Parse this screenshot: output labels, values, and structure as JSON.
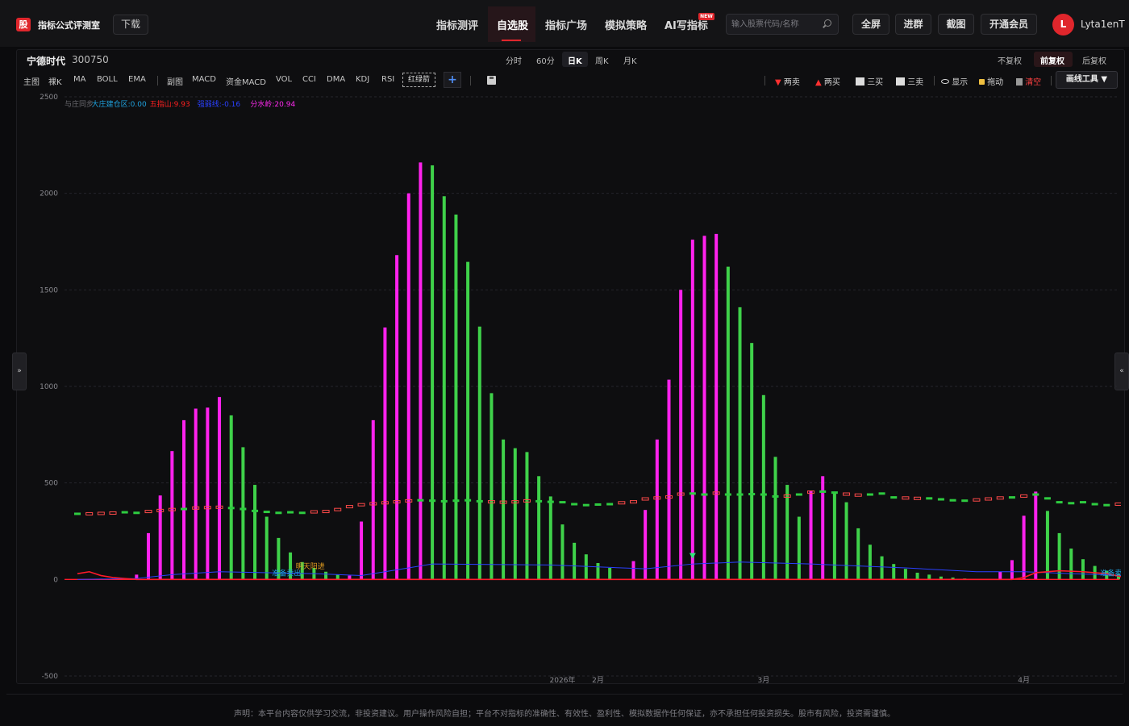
{
  "header": {
    "logo_char": "股",
    "site_title": "指标公式评测室",
    "download_label": "下载",
    "nav": [
      "指标测评",
      "自选股",
      "指标广场",
      "模拟策略",
      "AI写指标"
    ],
    "nav_active": "自选股",
    "new_badge": "NEW",
    "search_placeholder": "输入股票代码/名称",
    "buttons": [
      "全屏",
      "进群",
      "截图",
      "开通会员"
    ],
    "avatar_letter": "L",
    "username": "Lyta1enT"
  },
  "stock": {
    "name": "宁德时代",
    "code": "300750"
  },
  "periods": [
    "分时",
    "60分",
    "日K",
    "周K",
    "月K"
  ],
  "period_active": "日K",
  "adjust": [
    "不复权",
    "前复权",
    "后复权"
  ],
  "adjust_active": "前复权",
  "indicators_main": [
    "主图",
    "裸K",
    "MA",
    "BOLL",
    "EMA"
  ],
  "indicators_sub": [
    "副图",
    "MACD",
    "资金MACD",
    "VOL",
    "CCI",
    "DMA",
    "KDJ",
    "RSI"
  ],
  "highlight_indicator": "红绿箭",
  "add_label": "+",
  "tools": {
    "two_sell": "两卖",
    "two_buy": "两买",
    "three_buy": "三买",
    "three_sell": "三卖",
    "show": "显示",
    "drag": "拖动",
    "clear": "清空",
    "draw_tools": "画线工具 ▼"
  },
  "side": {
    "left": "»",
    "right": "«"
  },
  "chart_data": {
    "type": "bar",
    "legend": [
      {
        "label": "与庄同步",
        "color": "#6a6a70"
      },
      {
        "label": "大庄建仓区:0.00",
        "color": "#1fa3e0"
      },
      {
        "label": "五指山:9.93",
        "color": "#ff2020"
      },
      {
        "label": "强弱线:-0.16",
        "color": "#2a40ff"
      },
      {
        "label": "分水岭:20.94",
        "color": "#ff2af0"
      }
    ],
    "yticks": [
      2500,
      2000,
      1500,
      1000,
      500,
      0,
      -500
    ],
    "ylim": [
      -500,
      2500
    ],
    "xlabels": [
      {
        "i": 41,
        "label": "2026年"
      },
      {
        "i": 44,
        "label": "2月"
      },
      {
        "i": 58,
        "label": "3月"
      },
      {
        "i": 80,
        "label": "4月"
      }
    ],
    "annotations": [
      {
        "i": 19,
        "text": "明天阳进",
        "color": "#e8a020",
        "y": 55
      },
      {
        "i": 17,
        "text": "准备卖出",
        "color": "#1fa3e0",
        "y": 20
      },
      {
        "i": 87,
        "text": "准备卖出",
        "color": "#1fa3e0",
        "y": 20
      }
    ],
    "bars": [
      [
        0,
        "m"
      ],
      [
        0,
        "m"
      ],
      [
        0,
        "m"
      ],
      [
        0,
        "m"
      ],
      [
        0,
        "m"
      ],
      [
        25,
        "m"
      ],
      [
        240,
        "m"
      ],
      [
        435,
        "m"
      ],
      [
        665,
        "m"
      ],
      [
        825,
        "m"
      ],
      [
        885,
        "m"
      ],
      [
        890,
        "m"
      ],
      [
        945,
        "m"
      ],
      [
        850,
        "g"
      ],
      [
        685,
        "g"
      ],
      [
        490,
        "g"
      ],
      [
        325,
        "g"
      ],
      [
        215,
        "g"
      ],
      [
        140,
        "g"
      ],
      [
        90,
        "g"
      ],
      [
        60,
        "g"
      ],
      [
        40,
        "g"
      ],
      [
        25,
        "g"
      ],
      [
        20,
        "m"
      ],
      [
        300,
        "m"
      ],
      [
        825,
        "m"
      ],
      [
        1305,
        "m"
      ],
      [
        1680,
        "m"
      ],
      [
        2000,
        "m"
      ],
      [
        2160,
        "m"
      ],
      [
        2145,
        "g"
      ],
      [
        1985,
        "g"
      ],
      [
        1890,
        "g"
      ],
      [
        1645,
        "g"
      ],
      [
        1310,
        "g"
      ],
      [
        965,
        "g"
      ],
      [
        725,
        "g"
      ],
      [
        680,
        "g"
      ],
      [
        660,
        "g"
      ],
      [
        535,
        "g"
      ],
      [
        430,
        "g"
      ],
      [
        285,
        "g"
      ],
      [
        190,
        "g"
      ],
      [
        130,
        "g"
      ],
      [
        85,
        "g"
      ],
      [
        60,
        "g"
      ],
      [
        0,
        "m"
      ],
      [
        95,
        "m"
      ],
      [
        360,
        "m"
      ],
      [
        725,
        "m"
      ],
      [
        1035,
        "m"
      ],
      [
        1500,
        "m"
      ],
      [
        1760,
        "m"
      ],
      [
        1780,
        "m"
      ],
      [
        1790,
        "m"
      ],
      [
        1620,
        "g"
      ],
      [
        1410,
        "g"
      ],
      [
        1225,
        "g"
      ],
      [
        955,
        "g"
      ],
      [
        635,
        "g"
      ],
      [
        490,
        "g"
      ],
      [
        325,
        "g"
      ],
      [
        460,
        "m"
      ],
      [
        535,
        "m"
      ],
      [
        450,
        "g"
      ],
      [
        400,
        "g"
      ],
      [
        265,
        "g"
      ],
      [
        180,
        "g"
      ],
      [
        120,
        "g"
      ],
      [
        80,
        "g"
      ],
      [
        55,
        "g"
      ],
      [
        35,
        "g"
      ],
      [
        25,
        "g"
      ],
      [
        15,
        "g"
      ],
      [
        10,
        "g"
      ],
      [
        5,
        "g"
      ],
      [
        0,
        "m"
      ],
      [
        0,
        "m"
      ],
      [
        40,
        "m"
      ],
      [
        100,
        "m"
      ],
      [
        330,
        "m"
      ],
      [
        455,
        "m"
      ],
      [
        355,
        "g"
      ],
      [
        240,
        "g"
      ],
      [
        160,
        "g"
      ],
      [
        105,
        "g"
      ],
      [
        70,
        "g"
      ],
      [
        45,
        "g"
      ],
      [
        30,
        "g"
      ],
      [
        20,
        "g"
      ]
    ],
    "kline": [
      [
        340,
        "g"
      ],
      [
        338,
        "m"
      ],
      [
        340,
        "m"
      ],
      [
        342,
        "m"
      ],
      [
        348,
        "g"
      ],
      [
        345,
        "g"
      ],
      [
        350,
        "m"
      ],
      [
        355,
        "m"
      ],
      [
        360,
        "m"
      ],
      [
        365,
        "g"
      ],
      [
        368,
        "m"
      ],
      [
        370,
        "m"
      ],
      [
        372,
        "m"
      ],
      [
        370,
        "g"
      ],
      [
        365,
        "g"
      ],
      [
        355,
        "g"
      ],
      [
        350,
        "g"
      ],
      [
        345,
        "g"
      ],
      [
        348,
        "g"
      ],
      [
        345,
        "g"
      ],
      [
        348,
        "m"
      ],
      [
        350,
        "m"
      ],
      [
        360,
        "m"
      ],
      [
        375,
        "m"
      ],
      [
        385,
        "m"
      ],
      [
        390,
        "m"
      ],
      [
        395,
        "m"
      ],
      [
        400,
        "m"
      ],
      [
        405,
        "m"
      ],
      [
        410,
        "g"
      ],
      [
        408,
        "g"
      ],
      [
        405,
        "g"
      ],
      [
        408,
        "g"
      ],
      [
        410,
        "g"
      ],
      [
        405,
        "g"
      ],
      [
        400,
        "m"
      ],
      [
        398,
        "m"
      ],
      [
        400,
        "m"
      ],
      [
        405,
        "m"
      ],
      [
        405,
        "g"
      ],
      [
        402,
        "g"
      ],
      [
        400,
        "g"
      ],
      [
        390,
        "g"
      ],
      [
        385,
        "g"
      ],
      [
        388,
        "g"
      ],
      [
        390,
        "g"
      ],
      [
        395,
        "m"
      ],
      [
        400,
        "m"
      ],
      [
        415,
        "m"
      ],
      [
        420,
        "m"
      ],
      [
        425,
        "m"
      ],
      [
        440,
        "m"
      ],
      [
        445,
        "g"
      ],
      [
        440,
        "g"
      ],
      [
        445,
        "m"
      ],
      [
        440,
        "g"
      ],
      [
        440,
        "g"
      ],
      [
        442,
        "g"
      ],
      [
        440,
        "g"
      ],
      [
        430,
        "g"
      ],
      [
        430,
        "m"
      ],
      [
        440,
        "g"
      ],
      [
        450,
        "m"
      ],
      [
        455,
        "g"
      ],
      [
        450,
        "g"
      ],
      [
        440,
        "m"
      ],
      [
        435,
        "m"
      ],
      [
        440,
        "g"
      ],
      [
        445,
        "g"
      ],
      [
        425,
        "g"
      ],
      [
        420,
        "m"
      ],
      [
        418,
        "m"
      ],
      [
        420,
        "g"
      ],
      [
        415,
        "g"
      ],
      [
        410,
        "g"
      ],
      [
        408,
        "g"
      ],
      [
        410,
        "m"
      ],
      [
        415,
        "m"
      ],
      [
        420,
        "m"
      ],
      [
        425,
        "g"
      ],
      [
        430,
        "m"
      ],
      [
        440,
        "g"
      ],
      [
        420,
        "g"
      ],
      [
        400,
        "g"
      ],
      [
        395,
        "g"
      ],
      [
        400,
        "g"
      ],
      [
        390,
        "g"
      ],
      [
        385,
        "g"
      ],
      [
        388,
        "m"
      ],
      [
        395,
        "g"
      ]
    ],
    "red_line": [
      [
        0,
        30
      ],
      [
        1,
        40
      ],
      [
        2,
        20
      ],
      [
        3,
        10
      ],
      [
        4,
        5
      ],
      [
        5,
        0
      ],
      [
        79,
        0
      ],
      [
        80,
        10
      ],
      [
        81,
        35
      ],
      [
        83,
        45
      ],
      [
        85,
        40
      ],
      [
        87,
        30
      ],
      [
        89,
        5
      ]
    ],
    "blue_line": [
      [
        0,
        0
      ],
      [
        5,
        5
      ],
      [
        8,
        25
      ],
      [
        12,
        40
      ],
      [
        20,
        30
      ],
      [
        24,
        20
      ],
      [
        28,
        60
      ],
      [
        30,
        80
      ],
      [
        40,
        75
      ],
      [
        48,
        55
      ],
      [
        52,
        80
      ],
      [
        56,
        90
      ],
      [
        62,
        80
      ],
      [
        70,
        60
      ],
      [
        76,
        40
      ],
      [
        80,
        40
      ],
      [
        84,
        30
      ],
      [
        89,
        20
      ]
    ],
    "signals": [
      {
        "i": 52,
        "y": 120,
        "type": "down-green"
      }
    ]
  },
  "footer": "声明：本平台内容仅供学习交流，非投资建议。用户操作风险自担；平台不对指标的准确性、有效性、盈利性、模拟数据作任何保证，亦不承担任何投资损失。股市有风险，投资需谨慎。"
}
